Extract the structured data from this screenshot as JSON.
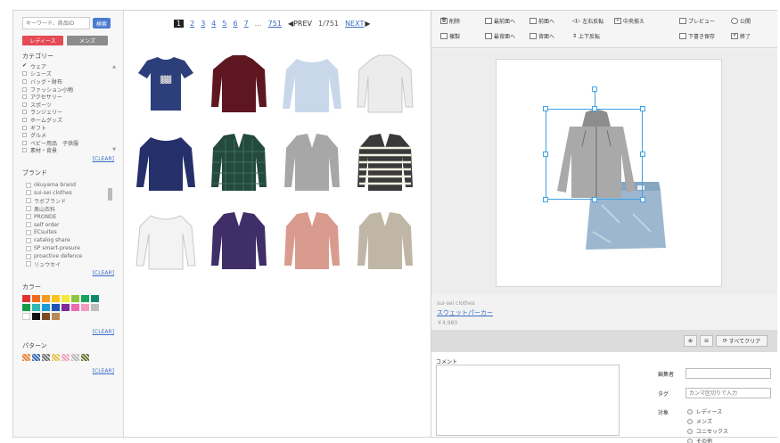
{
  "search": {
    "placeholder": "キーワード、商品ID",
    "button": "検索"
  },
  "gender": {
    "ladies": "レディース",
    "mens": "メンズ"
  },
  "categories": {
    "title": "カテゴリー",
    "items": [
      {
        "label": "ウェア",
        "checked": true
      },
      {
        "label": "シューズ",
        "checked": false
      },
      {
        "label": "バッグ・財布",
        "checked": false
      },
      {
        "label": "ファッション小物",
        "checked": false
      },
      {
        "label": "アクセサリー",
        "checked": false
      },
      {
        "label": "スポーツ",
        "checked": false
      },
      {
        "label": "ランジェリー",
        "checked": false
      },
      {
        "label": "ホームグッズ",
        "checked": false
      },
      {
        "label": "ギフト",
        "checked": false
      },
      {
        "label": "グルメ",
        "checked": false
      },
      {
        "label": "ベビー用品　子供服",
        "checked": false
      },
      {
        "label": "素材・背景",
        "checked": false
      }
    ],
    "clear": "[CLEAR]"
  },
  "brands": {
    "title": "ブランド",
    "items": [
      "okuyama brand",
      "sui-sei clothes",
      "ラボブランド",
      "奥山衣料",
      "PRONDE",
      "self order",
      "ECsuites",
      "catalog share",
      "SP smart-presure",
      "proactive defence",
      "リュウセイ"
    ],
    "clear": "[CLEAR]"
  },
  "colors": {
    "title": "カラー",
    "swatches": [
      "#e0332f",
      "#f06a1c",
      "#f39a20",
      "#f7c51d",
      "#f2e93a",
      "#8cc63f",
      "#16a45a",
      "#0d8a6c",
      "#139c4a",
      "#2fb7b3",
      "#1e9ad6",
      "#1c57b3",
      "#7b2c9a",
      "#ea6bb0",
      "#f49ac1",
      "#bdbdbd",
      "#ffffff",
      "#111111",
      "#7a4b23",
      "#b98a55"
    ],
    "clear": "[CLEAR]"
  },
  "patterns": {
    "title": "パターン",
    "icons": [
      "check-pattern-icon",
      "plaid-pattern-icon",
      "mono-pattern-icon",
      "floral-pattern-icon",
      "stripe-pattern-icon",
      "gray-pattern-icon",
      "camo-pattern-icon"
    ],
    "clear": "[CLEAR]"
  },
  "pager": {
    "pages": [
      "1",
      "2",
      "3",
      "4",
      "5",
      "6",
      "7"
    ],
    "dots": "…",
    "last": "751",
    "prev": "◀PREV",
    "count": "1/751",
    "next": "NEXT"
  },
  "products": [
    {
      "name": "navy-tshirt",
      "color": "#2c3f7a"
    },
    {
      "name": "burgundy-sweater",
      "color": "#5e1720"
    },
    {
      "name": "light-blue-longsleeve",
      "color": "#c9d7ea"
    },
    {
      "name": "white-turtleneck",
      "color": "#ececec"
    },
    {
      "name": "navy-cardigan",
      "color": "#25306b"
    },
    {
      "name": "green-plaid-shirt",
      "color": "#234a3d"
    },
    {
      "name": "gray-hoodie",
      "color": "#a7a7a7"
    },
    {
      "name": "striped-cardigan",
      "color": "#3a3a3a"
    },
    {
      "name": "white-shirt",
      "color": "#f3f3f3"
    },
    {
      "name": "purple-cardigan",
      "color": "#3f2e67"
    },
    {
      "name": "pink-cardigan",
      "color": "#d99b8e"
    },
    {
      "name": "beige-jacket",
      "color": "#bfb6a6"
    }
  ],
  "toolbar": {
    "delete": "削除",
    "front": "最前面へ",
    "back": "前面へ",
    "flip_h": "左右反転",
    "fit": "中央揃え",
    "preview": "プレビュー",
    "publish": "公開",
    "copy": "複製",
    "backmost": "最背面へ",
    "backward": "背面へ",
    "flip_v": "上下反転",
    "save_draft": "下書き保存",
    "finish": "終了"
  },
  "selected": {
    "brand": "sui-sei clothes",
    "name": "スウェットパーカー",
    "price": "￥4,980"
  },
  "zoom": {
    "clear_all": "すべてクリア"
  },
  "form": {
    "comment_label": "コメント",
    "editor_label": "編集者",
    "tag_label": "タグ",
    "tag_placeholder": "カンマ区切りで入力",
    "target_label": "対象",
    "targets": [
      "レディース",
      "メンズ",
      "ユニセックス",
      "その他"
    ]
  }
}
